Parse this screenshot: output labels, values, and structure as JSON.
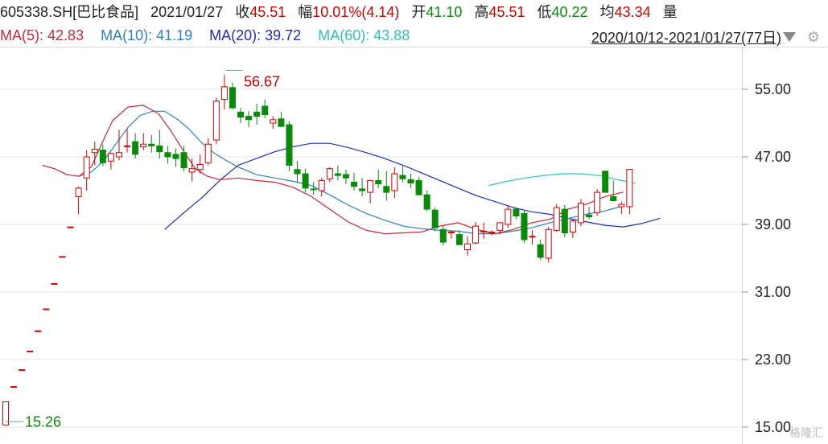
{
  "header": {
    "code": "605338.SH",
    "name": "[巴比食品]",
    "date": "2021/01/27",
    "close_label": "收",
    "close": "45.51",
    "change_label": "幅",
    "change": "10.01%(4.14)",
    "open_label": "开",
    "open": "41.10",
    "high_label": "高",
    "high": "45.51",
    "low_label": "低",
    "low": "40.22",
    "avg_label": "均",
    "avg": "43.34",
    "vol_label": "量"
  },
  "ma_line": {
    "ma5": "MA(5): 42.83",
    "ma10": "MA(10): 41.19",
    "ma20": "MA(20): 39.72",
    "ma60": "MA(60): 43.88",
    "range": "2020/10/12-2021/01/27(77日)"
  },
  "watermark": "格隆汇",
  "colors": {
    "up": "#d40000",
    "down": "#0a8a0a",
    "ma5": "#c8283c",
    "ma10": "#2f7fbf",
    "ma20": "#1f2fb5",
    "ma60": "#35c0b8"
  },
  "chart_data": {
    "type": "candlestick",
    "ylim": [
      15.0,
      57.0
    ],
    "y_ticks": [
      "55.00",
      "47.00",
      "39.00",
      "31.00",
      "23.00",
      "15.00"
    ],
    "y_tick_values": [
      55,
      47,
      39,
      31,
      23,
      15
    ],
    "annotations": {
      "max": "56.67",
      "min": "15.26"
    },
    "grid": true,
    "candles": [
      [
        15.26,
        18.0,
        15.26,
        18.0
      ],
      [
        19.8,
        19.8,
        19.8,
        19.8
      ],
      [
        21.8,
        21.8,
        21.8,
        21.8
      ],
      [
        24.0,
        24.0,
        24.0,
        24.0
      ],
      [
        26.4,
        26.4,
        26.4,
        26.4
      ],
      [
        29.0,
        29.0,
        29.0,
        29.0
      ],
      [
        32.0,
        32.0,
        32.0,
        32.0
      ],
      [
        35.2,
        35.2,
        35.2,
        35.2
      ],
      [
        38.7,
        38.7,
        38.7,
        38.7
      ],
      [
        42.3,
        43.5,
        40.2,
        43.3
      ],
      [
        44.5,
        47.8,
        43.0,
        47.0
      ],
      [
        47.5,
        48.8,
        46.0,
        47.9
      ],
      [
        47.8,
        48.5,
        45.9,
        46.3
      ],
      [
        46.5,
        47.5,
        45.5,
        47.4
      ],
      [
        47.0,
        50.2,
        46.6,
        47.5
      ],
      [
        48.3,
        50.3,
        47.5,
        48.3
      ],
      [
        48.8,
        49.8,
        46.8,
        47.3
      ],
      [
        48.2,
        49.8,
        47.8,
        48.5
      ],
      [
        48.5,
        49.6,
        47.5,
        48.3
      ],
      [
        48.3,
        50.2,
        46.8,
        47.6
      ],
      [
        47.5,
        48.3,
        46.2,
        47.0
      ],
      [
        47.3,
        48.0,
        45.8,
        46.8
      ],
      [
        47.5,
        48.3,
        45.3,
        45.7
      ],
      [
        45.2,
        46.8,
        44.1,
        45.6
      ],
      [
        45.5,
        47.3,
        45.0,
        46.1
      ],
      [
        46.3,
        49.2,
        46.0,
        48.5
      ],
      [
        49.0,
        54.0,
        48.5,
        53.6
      ],
      [
        53.8,
        56.67,
        52.6,
        55.3
      ],
      [
        55.2,
        55.8,
        52.6,
        52.8
      ],
      [
        52.3,
        52.8,
        51.0,
        51.7
      ],
      [
        51.8,
        52.4,
        50.5,
        51.4
      ],
      [
        52.3,
        53.3,
        50.8,
        51.8
      ],
      [
        53.0,
        53.8,
        51.6,
        52.0
      ],
      [
        51.0,
        51.8,
        50.3,
        51.4
      ],
      [
        51.5,
        52.3,
        50.5,
        50.6
      ],
      [
        50.8,
        51.2,
        45.3,
        46.0
      ],
      [
        45.5,
        46.5,
        44.0,
        45.0
      ],
      [
        45.0,
        45.6,
        42.8,
        43.3
      ],
      [
        43.2,
        44.0,
        42.5,
        43.1
      ],
      [
        43.0,
        44.5,
        42.3,
        44.2
      ],
      [
        44.4,
        45.8,
        44.0,
        45.6
      ],
      [
        45.0,
        46.0,
        44.2,
        44.8
      ],
      [
        44.9,
        45.5,
        43.8,
        44.5
      ],
      [
        44.0,
        45.1,
        43.0,
        43.5
      ],
      [
        43.2,
        44.5,
        42.3,
        43.0
      ],
      [
        42.8,
        44.3,
        41.5,
        44.2
      ],
      [
        44.2,
        45.5,
        43.3,
        43.8
      ],
      [
        43.5,
        45.3,
        41.8,
        42.8
      ],
      [
        43.0,
        45.8,
        42.1,
        45.0
      ],
      [
        44.8,
        45.9,
        44.0,
        44.4
      ],
      [
        44.3,
        45.0,
        43.3,
        43.9
      ],
      [
        44.2,
        44.6,
        42.5,
        42.5
      ],
      [
        42.5,
        43.0,
        40.6,
        40.8
      ],
      [
        40.7,
        41.0,
        38.2,
        38.6
      ],
      [
        38.4,
        38.8,
        36.5,
        36.9
      ],
      [
        38.0,
        38.3,
        37.3,
        38.1
      ],
      [
        37.8,
        38.3,
        36.6,
        36.6
      ],
      [
        36.0,
        37.6,
        35.3,
        36.7
      ],
      [
        36.8,
        39.3,
        36.6,
        38.8
      ],
      [
        38.1,
        39.2,
        37.3,
        38.2
      ],
      [
        38.0,
        38.3,
        37.7,
        38.1
      ],
      [
        38.3,
        39.3,
        37.8,
        39.2
      ],
      [
        39.0,
        41.3,
        38.6,
        40.8
      ],
      [
        40.8,
        41.0,
        39.6,
        40.0
      ],
      [
        40.3,
        40.7,
        36.8,
        37.2
      ],
      [
        37.5,
        38.3,
        36.6,
        37.6
      ],
      [
        36.6,
        37.2,
        34.8,
        35.1
      ],
      [
        35.0,
        38.7,
        34.5,
        38.4
      ],
      [
        38.3,
        41.4,
        38.1,
        41.0
      ],
      [
        40.8,
        41.3,
        37.5,
        38.0
      ],
      [
        38.1,
        39.6,
        37.4,
        39.4
      ],
      [
        39.2,
        42.0,
        38.8,
        41.5
      ],
      [
        40.1,
        41.1,
        39.6,
        39.9
      ],
      [
        40.4,
        43.2,
        40.0,
        42.8
      ],
      [
        45.3,
        45.4,
        42.8,
        42.8
      ],
      [
        42.3,
        44.2,
        41.9,
        41.8
      ],
      [
        41.1,
        41.7,
        40.22,
        41.37
      ],
      [
        41.1,
        45.51,
        40.22,
        45.51
      ]
    ],
    "ma5": [
      [
        12,
        46.0
      ],
      [
        16,
        45.6
      ],
      [
        20,
        44.9
      ],
      [
        24,
        44.7
      ],
      [
        28,
        45.8
      ],
      [
        32,
        49.0
      ],
      [
        35,
        51.3
      ],
      [
        40,
        52.9
      ],
      [
        45,
        53.1
      ],
      [
        50,
        52.1
      ],
      [
        54,
        50.1
      ],
      [
        58,
        47.8
      ],
      [
        62,
        45.6
      ],
      [
        66,
        44.7
      ],
      [
        70,
        44.3
      ],
      [
        76,
        44.5
      ],
      [
        82,
        44.2
      ],
      [
        88,
        44.0
      ],
      [
        94,
        43.4
      ],
      [
        100,
        42.3
      ],
      [
        106,
        40.8
      ],
      [
        112,
        39.3
      ],
      [
        118,
        38.3
      ],
      [
        124,
        37.9
      ],
      [
        130,
        38.0
      ],
      [
        136,
        38.1
      ],
      [
        142,
        38.8
      ],
      [
        148,
        39.2
      ],
      [
        154,
        38.4
      ],
      [
        160,
        37.9
      ],
      [
        166,
        38.4
      ],
      [
        172,
        39.2
      ],
      [
        178,
        39.6
      ],
      [
        184,
        40.8
      ],
      [
        190,
        41.4
      ],
      [
        196,
        42.3
      ],
      [
        202,
        42.83
      ]
    ],
    "ma10": [
      [
        24,
        44.7
      ],
      [
        28,
        45.2
      ],
      [
        32,
        46.5
      ],
      [
        36,
        48.5
      ],
      [
        40,
        50.5
      ],
      [
        44,
        51.9
      ],
      [
        48,
        52.4
      ],
      [
        52,
        52.4
      ],
      [
        56,
        51.5
      ],
      [
        60,
        50.3
      ],
      [
        64,
        48.7
      ],
      [
        68,
        47.5
      ],
      [
        72,
        46.6
      ],
      [
        76,
        45.8
      ],
      [
        82,
        44.9
      ],
      [
        88,
        44.5
      ],
      [
        94,
        44.1
      ],
      [
        100,
        43.6
      ],
      [
        106,
        42.5
      ],
      [
        112,
        41.3
      ],
      [
        118,
        40.3
      ],
      [
        124,
        39.5
      ],
      [
        130,
        38.8
      ],
      [
        136,
        38.5
      ],
      [
        142,
        38.3
      ],
      [
        148,
        38.2
      ],
      [
        154,
        37.9
      ],
      [
        160,
        37.9
      ],
      [
        166,
        38.2
      ],
      [
        172,
        38.6
      ],
      [
        178,
        39.2
      ],
      [
        184,
        39.7
      ],
      [
        190,
        40.2
      ],
      [
        196,
        40.6
      ],
      [
        202,
        41.19
      ]
    ],
    "ma20": [
      [
        52,
        38.4
      ],
      [
        58,
        40.3
      ],
      [
        64,
        42.1
      ],
      [
        70,
        44.2
      ],
      [
        76,
        46.0
      ],
      [
        82,
        46.8
      ],
      [
        88,
        47.6
      ],
      [
        94,
        48.2
      ],
      [
        100,
        48.6
      ],
      [
        106,
        48.6
      ],
      [
        112,
        48.1
      ],
      [
        118,
        47.5
      ],
      [
        124,
        46.8
      ],
      [
        130,
        46.0
      ],
      [
        136,
        45.1
      ],
      [
        142,
        44.2
      ],
      [
        148,
        43.3
      ],
      [
        154,
        42.4
      ],
      [
        160,
        41.7
      ],
      [
        166,
        41.0
      ],
      [
        172,
        40.5
      ],
      [
        178,
        40.2
      ],
      [
        184,
        39.7
      ],
      [
        190,
        39.3
      ],
      [
        196,
        38.9
      ],
      [
        202,
        38.7
      ],
      [
        208,
        39.1
      ],
      [
        214,
        39.72
      ]
    ],
    "ma60": [
      [
        158,
        43.6
      ],
      [
        164,
        44.1
      ],
      [
        170,
        44.5
      ],
      [
        176,
        44.8
      ],
      [
        182,
        45.0
      ],
      [
        188,
        45.0
      ],
      [
        194,
        44.8
      ],
      [
        200,
        44.3
      ],
      [
        206,
        43.88
      ]
    ]
  }
}
